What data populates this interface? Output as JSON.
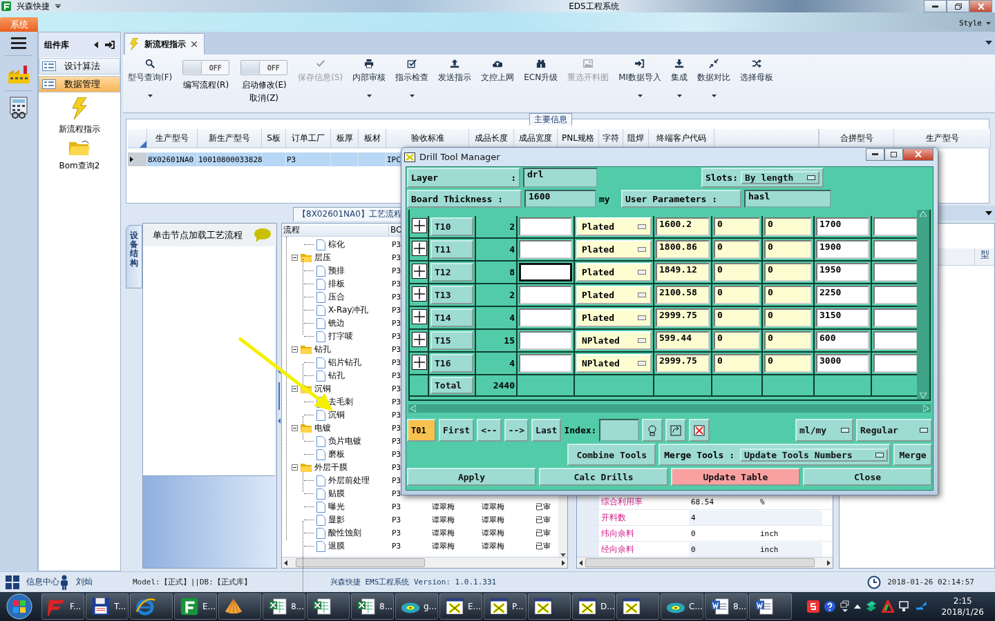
{
  "window": {
    "app_name": "兴森快捷",
    "title": "EDS工程系统"
  },
  "ribbon": {
    "tab": "系统",
    "style_menu": "Style"
  },
  "nav": {
    "header": "组件库",
    "items": [
      {
        "label": "设计算法",
        "selected": false
      },
      {
        "label": "数据管理",
        "selected": true
      }
    ],
    "tiles": [
      {
        "label": "新流程指示",
        "kind": "bolt"
      },
      {
        "label": "Bom查询2",
        "kind": "folder"
      }
    ]
  },
  "doc_tab": {
    "label": "新流程指示"
  },
  "toolbar": [
    {
      "kind": "search",
      "label": "型号查询(F)",
      "dropdown": true,
      "disabled": false
    },
    {
      "kind": "toggle",
      "state": "OFF",
      "on": false,
      "label": "编写流程(R)"
    },
    {
      "kind": "toggle",
      "state": "OFF",
      "on": false,
      "label": "启动修改(E)",
      "sublabel": "取消(Z)"
    },
    {
      "kind": "check",
      "label": "保存信息(S)",
      "dropdown": false,
      "disabled": true
    },
    {
      "kind": "printer",
      "label": "内部审核",
      "dropdown": true,
      "disabled": false
    },
    {
      "kind": "checkbox",
      "label": "指示检查",
      "dropdown": true,
      "disabled": false
    },
    {
      "kind": "upload",
      "label": "发送指示",
      "dropdown": false,
      "disabled": false
    },
    {
      "kind": "cloud",
      "label": "文控上网",
      "dropdown": false,
      "disabled": false
    },
    {
      "kind": "binoculars",
      "label": "ECN升级",
      "dropdown": false,
      "disabled": false
    },
    {
      "kind": "image",
      "label": "重选开料图",
      "dropdown": false,
      "disabled": true
    },
    {
      "kind": "signin",
      "label": "MI数据导入",
      "dropdown": true,
      "disabled": false
    },
    {
      "kind": "download",
      "label": "集成",
      "dropdown": true,
      "disabled": false
    },
    {
      "kind": "compress",
      "label": "数据对比",
      "dropdown": true,
      "disabled": false
    },
    {
      "kind": "shuffle",
      "label": "选择母板",
      "dropdown": false,
      "disabled": false
    }
  ],
  "main_info": {
    "title": "主要信息",
    "columns": [
      "生产型号",
      "新生产型号",
      "S板",
      "订单工厂",
      "板厚",
      "板材",
      "验收标准",
      "成品长度",
      "成品宽度",
      "PNL规格",
      "字符",
      "阻焊",
      "终端客户代码"
    ],
    "rows": [
      {
        "selected": true,
        "cells": [
          "8X02601NA0",
          "10010800033828",
          null,
          "P3",
          null,
          null,
          "IPC"
        ]
      }
    ]
  },
  "merge_grid": {
    "columns": [
      "合拼型号",
      "生产型号"
    ]
  },
  "process": {
    "tab": "【8X02601NA0】工艺流程",
    "side_tab": "设备结构",
    "hint": "单击节点加载工艺流程",
    "tree_columns": [
      "流程",
      "BO"
    ],
    "tree": [
      {
        "label": "棕化",
        "kind": "file",
        "cells": [
          "P3"
        ]
      },
      {
        "label": "层压",
        "kind": "folder",
        "expanded": true,
        "cells": [
          "P3"
        ],
        "children": [
          {
            "label": "预排",
            "kind": "file",
            "cells": [
              "P3"
            ]
          },
          {
            "label": "排板",
            "kind": "file",
            "cells": [
              "P3"
            ]
          },
          {
            "label": "压合",
            "kind": "file",
            "cells": [
              "P3"
            ]
          },
          {
            "label": "X-Ray冲孔",
            "kind": "file",
            "cells": [
              "P3"
            ]
          },
          {
            "label": "铣边",
            "kind": "file",
            "cells": [
              "P3"
            ]
          },
          {
            "label": "打字唛",
            "kind": "file",
            "cells": [
              "P3"
            ]
          }
        ]
      },
      {
        "label": "钻孔",
        "kind": "folder",
        "expanded": true,
        "cells": [
          "P3"
        ],
        "children": [
          {
            "label": "铝片钻孔",
            "kind": "file",
            "cells": [
              "P3"
            ]
          },
          {
            "label": "钻孔",
            "kind": "file",
            "cells": [
              "P3"
            ]
          }
        ]
      },
      {
        "label": "沉铜",
        "kind": "folder",
        "expanded": true,
        "cells": [
          "P3"
        ],
        "children": [
          {
            "label": "去毛刺",
            "kind": "file",
            "cells": [
              "P3"
            ]
          },
          {
            "label": "沉铜",
            "kind": "file",
            "cells": [
              "P3"
            ]
          }
        ]
      },
      {
        "label": "电镀",
        "kind": "folder",
        "expanded": true,
        "cells": [
          "P3"
        ],
        "children": [
          {
            "label": "负片电镀",
            "kind": "file",
            "cells": [
              "P3"
            ]
          },
          {
            "label": "磨板",
            "kind": "file",
            "cells": [
              "P3"
            ]
          }
        ]
      },
      {
        "label": "外层干膜",
        "kind": "folder",
        "expanded": true,
        "cells": [
          "P3"
        ],
        "children": [
          {
            "label": "外层前处理",
            "kind": "file",
            "cells": [
              "P3"
            ]
          },
          {
            "label": "贴膜",
            "kind": "file",
            "cells": [
              "P3"
            ]
          },
          {
            "label": "曝光",
            "kind": "file",
            "cells": [
              "P3",
              "谭翠梅",
              "谭翠梅",
              "已审"
            ]
          },
          {
            "label": "显影",
            "kind": "file",
            "cells": [
              "P3",
              "谭翠梅",
              "谭翠梅",
              "已审"
            ]
          },
          {
            "label": "酸性蚀刻",
            "kind": "file",
            "cells": [
              "P3",
              "谭翠梅",
              "谭翠梅",
              "已审"
            ]
          },
          {
            "label": "退膜",
            "kind": "file",
            "cells": [
              "P3",
              "谭翠梅",
              "谭翠梅",
              "已审"
            ]
          }
        ]
      }
    ]
  },
  "properties": [
    {
      "label": "综合利用率",
      "value": "68.54",
      "unit": "%"
    },
    {
      "label": "开料数",
      "value": "4"
    },
    {
      "label": "纬向余料",
      "value": "0",
      "unit": "inch"
    },
    {
      "label": "经向余料",
      "value": "0",
      "unit": "inch"
    }
  ],
  "right_panel": {
    "column": "型"
  },
  "drill_dialog": {
    "title": "Drill Tool Manager",
    "layer_label": "Layer",
    "layer_colon": ":",
    "layer": "drl",
    "slots_label": "Slots:",
    "slots": "By length",
    "thickness_label": "Board Thickness :",
    "thickness": "1600",
    "thickness_unit": "my",
    "user_params_label": "User Parameters :",
    "user_params": "hasl",
    "tools": [
      {
        "name": "T10",
        "count": "2",
        "type": "Plated",
        "column_5": "1600.2",
        "column_6": "0",
        "column_7": "0",
        "column_8": "1700",
        "focused": false
      },
      {
        "name": "T11",
        "count": "4",
        "type": "Plated",
        "column_5": "1800.86",
        "column_6": "0",
        "column_7": "0",
        "column_8": "1900",
        "focused": false
      },
      {
        "name": "T12",
        "count": "8",
        "type": "Plated",
        "column_5": "1849.12",
        "column_6": "0",
        "column_7": "0",
        "column_8": "1950",
        "focused": true
      },
      {
        "name": "T13",
        "count": "2",
        "type": "Plated",
        "column_5": "2100.58",
        "column_6": "0",
        "column_7": "0",
        "column_8": "2250",
        "focused": false
      },
      {
        "name": "T14",
        "count": "4",
        "type": "Plated",
        "column_5": "2999.75",
        "column_6": "0",
        "column_7": "0",
        "column_8": "3150",
        "focused": false
      },
      {
        "name": "T15",
        "count": "15",
        "type": "NPlated",
        "column_5": "599.44",
        "column_6": "0",
        "column_7": "0",
        "column_8": "600",
        "focused": false
      },
      {
        "name": "T16",
        "count": "4",
        "type": "NPlated",
        "column_5": "2999.75",
        "column_6": "0",
        "column_7": "0",
        "column_8": "3000",
        "focused": false
      }
    ],
    "total": {
      "label": "Total",
      "count": "2440"
    },
    "current_tool": "T01",
    "nav_buttons": [
      "First",
      "<--",
      "-->",
      "Last"
    ],
    "index_label": "Index:",
    "units": "ml/my",
    "mode": "Regular",
    "combine": "Combine Tools",
    "merge_label": "Merge Tools :",
    "merge_mode": "Update Tools Numbers",
    "merge": "Merge",
    "actions": [
      {
        "label": "Apply",
        "kind": "normal"
      },
      {
        "label": "Calc Drills",
        "kind": "normal"
      },
      {
        "label": "Update Table",
        "kind": "highlight"
      },
      {
        "label": "Close",
        "kind": "normal"
      }
    ]
  },
  "status": {
    "info": "信息中心",
    "user": "刘灿",
    "model": "Model:【正式】||DB:【正式库】",
    "app": "兴森快捷 EMS工程系统 Version: 1.0.1.331",
    "datetime": "2018-01-26 02:14:57"
  },
  "taskbar": {
    "items": [
      {
        "kind": "foxit",
        "label": "F..."
      },
      {
        "kind": "disk",
        "label": "T..."
      },
      {
        "kind": "ie"
      },
      {
        "kind": "app",
        "label": "E..."
      },
      {
        "kind": "shell"
      },
      {
        "kind": "excel",
        "label": "8..."
      },
      {
        "kind": "excel"
      },
      {
        "kind": "excel",
        "label": "8..."
      },
      {
        "kind": "disc",
        "label": "g..."
      },
      {
        "kind": "xwin",
        "label": "E..."
      },
      {
        "kind": "xwin",
        "label": "P..."
      },
      {
        "kind": "xwin"
      },
      {
        "kind": "xwin",
        "label": "D..."
      },
      {
        "kind": "xwin"
      },
      {
        "kind": "disc",
        "label": "C..."
      },
      {
        "kind": "word",
        "label": "8..."
      },
      {
        "kind": "word"
      }
    ],
    "time": "2:15",
    "date": "2018/1/26"
  }
}
